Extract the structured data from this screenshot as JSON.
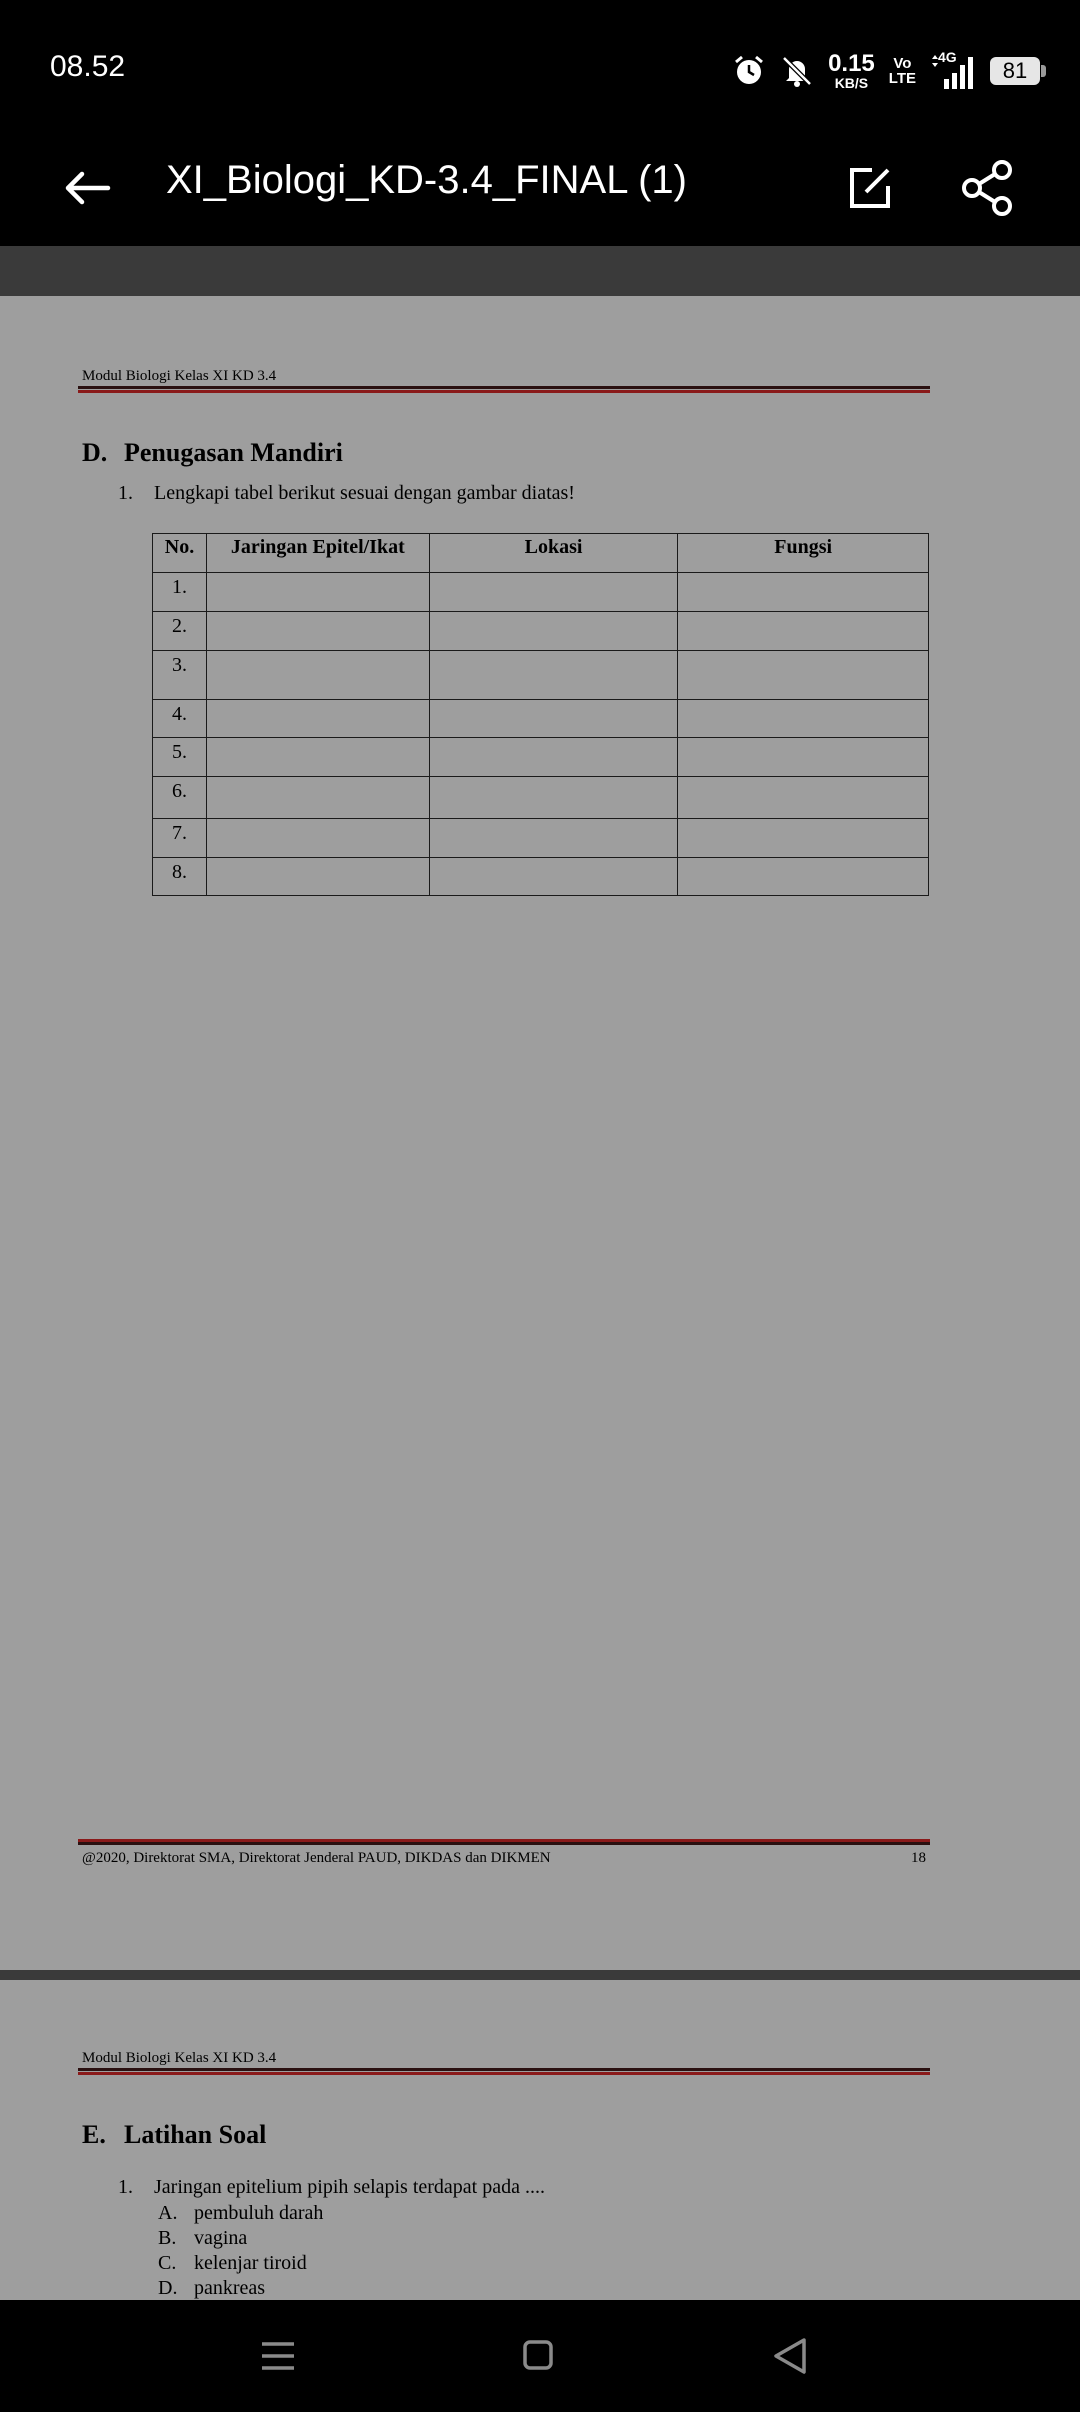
{
  "status_bar": {
    "time": "08.52",
    "net_speed_value": "0.15",
    "net_speed_unit": "KB/S",
    "volte_top": "Vo",
    "volte_bottom": "LTE",
    "network_type": "4G",
    "battery_level": "81",
    "icons": [
      "alarm-icon",
      "bell-off-icon",
      "signal-icon"
    ]
  },
  "app_bar": {
    "title": "XI_Biologi_KD-3.4_FINAL (1)",
    "icons": [
      "back-arrow-icon",
      "edit-icon",
      "share-icon"
    ]
  },
  "page1": {
    "header": "Modul Biologi Kelas XI KD 3.4",
    "section_letter": "D.",
    "section_title": "Penugasan Mandiri",
    "item_number": "1.",
    "item_text": "Lengkapi tabel berikut sesuai dengan gambar diatas!",
    "table": {
      "headers": [
        "No.",
        "Jaringan Epitel/Ikat",
        "Lokasi",
        "Fungsi"
      ],
      "rows": [
        "1.",
        "2.",
        "3.",
        "4.",
        "5.",
        "6.",
        "7.",
        "8."
      ]
    },
    "footer": "@2020, Direktorat SMA, Direktorat Jenderal PAUD, DIKDAS dan DIKMEN",
    "page_number": "18"
  },
  "page2": {
    "header": "Modul Biologi Kelas XI KD 3.4",
    "section_letter": "E.",
    "section_title": "Latihan Soal",
    "question_number": "1.",
    "question_text": "Jaringan epitelium pipih selapis terdapat pada ....",
    "options": [
      {
        "letter": "A.",
        "text": "pembuluh darah"
      },
      {
        "letter": "B.",
        "text": "vagina"
      },
      {
        "letter": "C.",
        "text": "kelenjar tiroid"
      },
      {
        "letter": "D.",
        "text": "pankreas"
      }
    ]
  },
  "nav_bar": {
    "icons": [
      "menu-icon",
      "home-icon",
      "back-triangle-icon"
    ]
  },
  "colors": {
    "page_background": "#9e9e9e",
    "viewer_background": "#3a3a3a",
    "rule_red": "#8a1a1a"
  }
}
